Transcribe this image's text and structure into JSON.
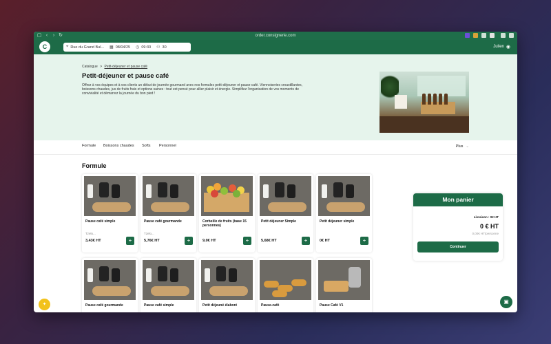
{
  "browser": {
    "url": "order.consignerie.com"
  },
  "header": {
    "logo_text": "C",
    "address": "Rue du Grand Bul...",
    "date": "08/04/25",
    "time": "09:30",
    "people": "30",
    "user_name": "Julien"
  },
  "hero": {
    "breadcrumb_root": "Catalogue",
    "breadcrumb_sep": ">",
    "breadcrumb_current": "Petit-déjeuner et pause café",
    "title": "Petit-déjeuner et pause café",
    "description": "Offrez à vos équipes et à vos clients un début de journée gourmand avec nos formules petit-déjeuner et pause café. Viennoiseries croustillantes, boissons chaudes, jus de fruits frais et options saines : tout est pensé pour allier plaisir et énergie. Simplifiez l'organisation de vos moments de convivialité et démarrez la journée du bon pied !"
  },
  "tabs": [
    "Formule",
    "Boissons chaudes",
    "Softs",
    "Personnel"
  ],
  "more_label": "Plus",
  "section_title": "Formule",
  "products": [
    {
      "name": "Pause café simple",
      "sub": "Tzelo...",
      "price": "3,43€ HT",
      "image": "coffee"
    },
    {
      "name": "Pause café gourmande",
      "sub": "Tzelo...",
      "price": "5,76€ HT",
      "image": "coffee"
    },
    {
      "name": "Corbeille de fruits (base 15 personnes)",
      "sub": "",
      "price": "9,0€ HT",
      "image": "fruit"
    },
    {
      "name": "Petit déjeuner Simple",
      "sub": "",
      "price": "5,68€ HT",
      "image": "coffee"
    },
    {
      "name": "Petit déjeuner simple",
      "sub": "",
      "price": "0€ HT",
      "image": "coffee"
    },
    {
      "name": "Pause café gourmande",
      "sub": "",
      "price": "",
      "image": "coffee"
    },
    {
      "name": "Pause café simple",
      "sub": "",
      "price": "",
      "image": "coffee"
    },
    {
      "name": "Petit déjeuné élaboré",
      "sub": "",
      "price": "",
      "image": "coffee"
    },
    {
      "name": "Pause-café",
      "sub": "",
      "price": "",
      "image": "croissant"
    },
    {
      "name": "Pause Café V1",
      "sub": "",
      "price": "",
      "image": "pastry"
    }
  ],
  "basket": {
    "title": "Mon panier",
    "delivery": "Livraison : 0€ HT",
    "total": "0 € HT",
    "per_person": "0,00€ HT/personne",
    "continue_label": "Continuer"
  },
  "colors": {
    "brand_green": "#1d6b47",
    "hero_bg": "#e6f4ec",
    "chat_yellow": "#f2c21b"
  }
}
